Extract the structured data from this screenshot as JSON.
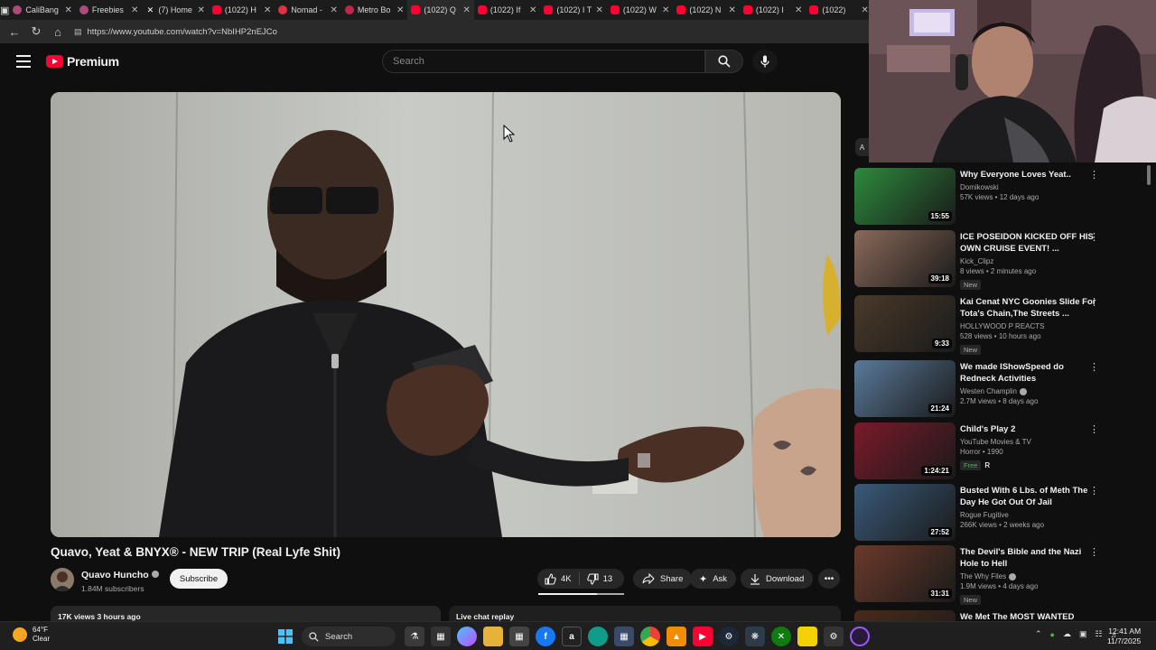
{
  "browser": {
    "tabs": [
      {
        "label": "CaliBang",
        "icon": "cb",
        "active": false
      },
      {
        "label": "Freebies",
        "icon": "cb",
        "active": false
      },
      {
        "label": "(7) Home",
        "icon": "x",
        "active": false
      },
      {
        "label": "(1022) H",
        "icon": "yt",
        "active": false
      },
      {
        "label": "Nomad -",
        "icon": "nm",
        "active": false
      },
      {
        "label": "Metro Bo",
        "icon": "mb",
        "active": false
      },
      {
        "label": "(1022) Q",
        "icon": "yt",
        "active": true
      },
      {
        "label": "(1022) If",
        "icon": "yt",
        "active": false
      },
      {
        "label": "(1022) I T",
        "icon": "yt",
        "active": false
      },
      {
        "label": "(1022) W",
        "icon": "yt",
        "active": false
      },
      {
        "label": "(1022) N",
        "icon": "yt",
        "active": false
      },
      {
        "label": "(1022) I",
        "icon": "yt",
        "active": false
      },
      {
        "label": "(1022)",
        "icon": "yt",
        "active": false
      }
    ],
    "url": "https://www.youtube.com/watch?v=NbIHP2nEJCo"
  },
  "youtube": {
    "logo_text": "Premium",
    "search_placeholder": "Search",
    "brand_color": "#ff0033"
  },
  "video": {
    "title": "Quavo, Yeat & BNYX® - NEW TRIP (Real Lyfe Shit)",
    "channel": "Quavo Huncho",
    "subscribers": "1.84M subscribers",
    "subscribe_label": "Subscribe",
    "likes": "4K",
    "dislikes": "13",
    "like_fraction": 0.68,
    "share_label": "Share",
    "ask_label": "Ask",
    "download_label": "Download",
    "description_preview": "17K views  3 hours ago",
    "chat_label": "Live chat replay"
  },
  "sidebar": {
    "chip_label": "A",
    "related": [
      {
        "title": "Why Everyone Loves Yeat..",
        "channel": "Domikowski",
        "meta": "57K views • 12 days ago",
        "duration": "15:55",
        "badge": "",
        "verified": false,
        "thumb": "#2d8a3c"
      },
      {
        "title": "ICE POSEIDON KICKED OFF HIS OWN CRUISE EVENT! ...",
        "channel": "Kick_Clipz",
        "meta": "8 views • 2 minutes ago",
        "duration": "39:18",
        "badge": "New",
        "verified": false,
        "thumb": "#8b6a5a"
      },
      {
        "title": "Kai Cenat NYC Goonies Slide For Tota's Chain,The Streets ...",
        "channel": "HOLLYWOOD P REACTS",
        "meta": "528 views • 10 hours ago",
        "duration": "9:33",
        "badge": "New",
        "verified": false,
        "thumb": "#4a3a2a"
      },
      {
        "title": "We made IShowSpeed do Redneck Activities",
        "channel": "Westen Champlin",
        "meta": "2.7M views • 8 days ago",
        "duration": "21:24",
        "badge": "",
        "verified": true,
        "thumb": "#5a7a9a"
      },
      {
        "title": "Child's Play 2",
        "channel": "YouTube Movies & TV",
        "meta": "Horror • 1990",
        "duration": "1:24:21",
        "badge": "Free",
        "rating": "R",
        "verified": false,
        "thumb": "#7a1a2a"
      },
      {
        "title": "Busted With 6 Lbs. of Meth The Day He Got Out Of Jail",
        "channel": "Rogue Fugitive",
        "meta": "266K views • 2 weeks ago",
        "duration": "27:52",
        "badge": "",
        "verified": false,
        "thumb": "#3a5a7a"
      },
      {
        "title": "The Devil's Bible and the Nazi Hole to Hell",
        "channel": "The Why Files",
        "meta": "1.9M views • 4 days ago",
        "duration": "31:31",
        "badge": "New",
        "verified": true,
        "thumb": "#6a3a2a"
      },
      {
        "title": "We Met The MOST WANTED",
        "channel": "",
        "meta": "",
        "duration": "",
        "badge": "",
        "verified": false,
        "thumb": "#4a2a1a"
      }
    ]
  },
  "taskbar": {
    "temperature": "64°F",
    "condition": "Clear",
    "search_label": "Search",
    "time": "12:41 AM",
    "date": "11/7/2025"
  }
}
